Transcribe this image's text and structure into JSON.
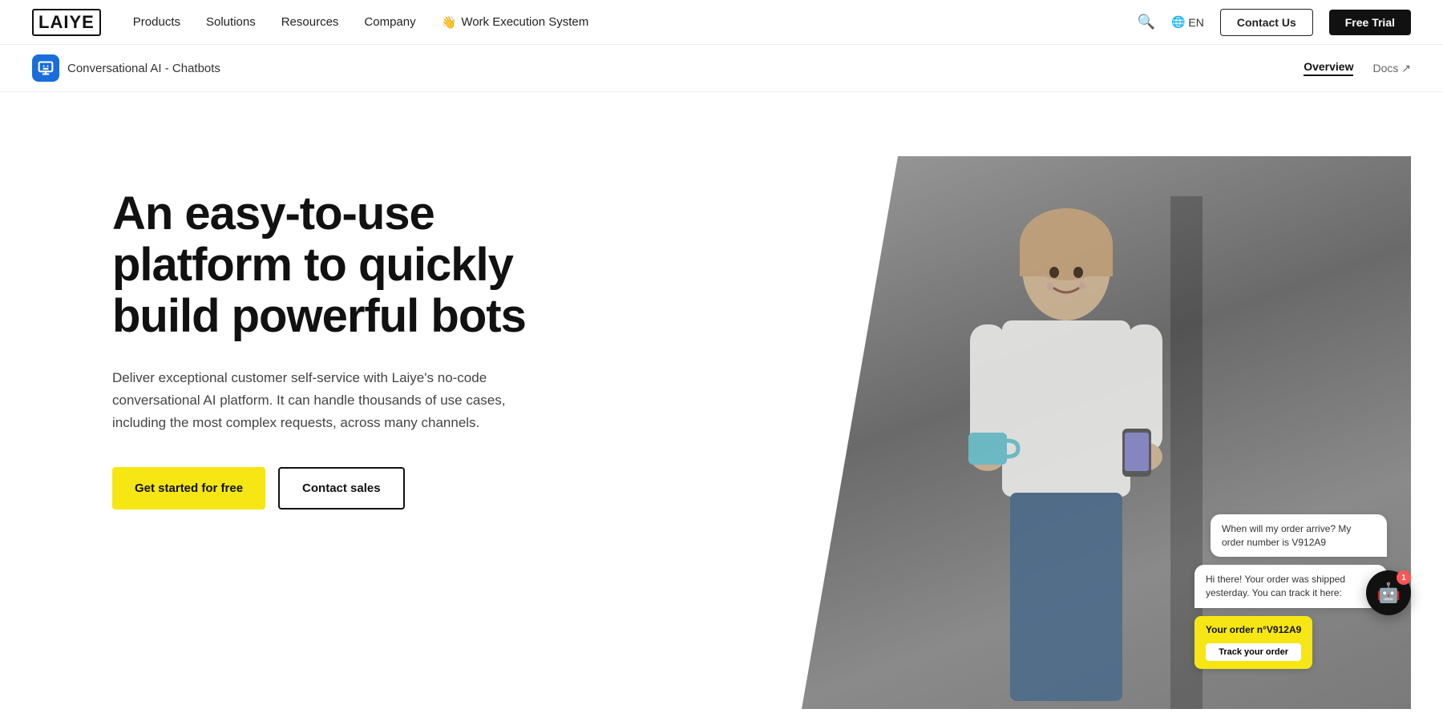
{
  "navbar": {
    "logo": "LAIYE",
    "links": [
      {
        "label": "Products",
        "id": "products"
      },
      {
        "label": "Solutions",
        "id": "solutions"
      },
      {
        "label": "Resources",
        "id": "resources"
      },
      {
        "label": "Company",
        "id": "company"
      }
    ],
    "work_execution": {
      "icon": "👋",
      "label": "Work Execution System"
    },
    "search_icon": "🔍",
    "language": {
      "icon": "🌐",
      "label": "EN"
    },
    "contact_label": "Contact Us",
    "trial_label": "Free Trial"
  },
  "subheader": {
    "icon_label": "💬",
    "title": "Conversational AI - Chatbots",
    "overview_label": "Overview",
    "docs_label": "Docs ↗"
  },
  "hero": {
    "title": "An easy-to-use platform to quickly build powerful bots",
    "description": "Deliver exceptional customer self-service with Laiye's no-code conversational AI platform. It can handle thousands of use cases, including the most complex requests, across many channels.",
    "cta_primary": "Get started for free",
    "cta_secondary": "Contact sales",
    "chat": {
      "user_message": "When will my order arrive? My order number is V912A9",
      "bot_message": "Hi there! Your order was shipped yesterday. You can track it here:",
      "order_title": "Your order n°V912A9",
      "track_label": "Track your order"
    }
  },
  "chatbot_fab": {
    "badge": "1",
    "icon": "🤖"
  }
}
